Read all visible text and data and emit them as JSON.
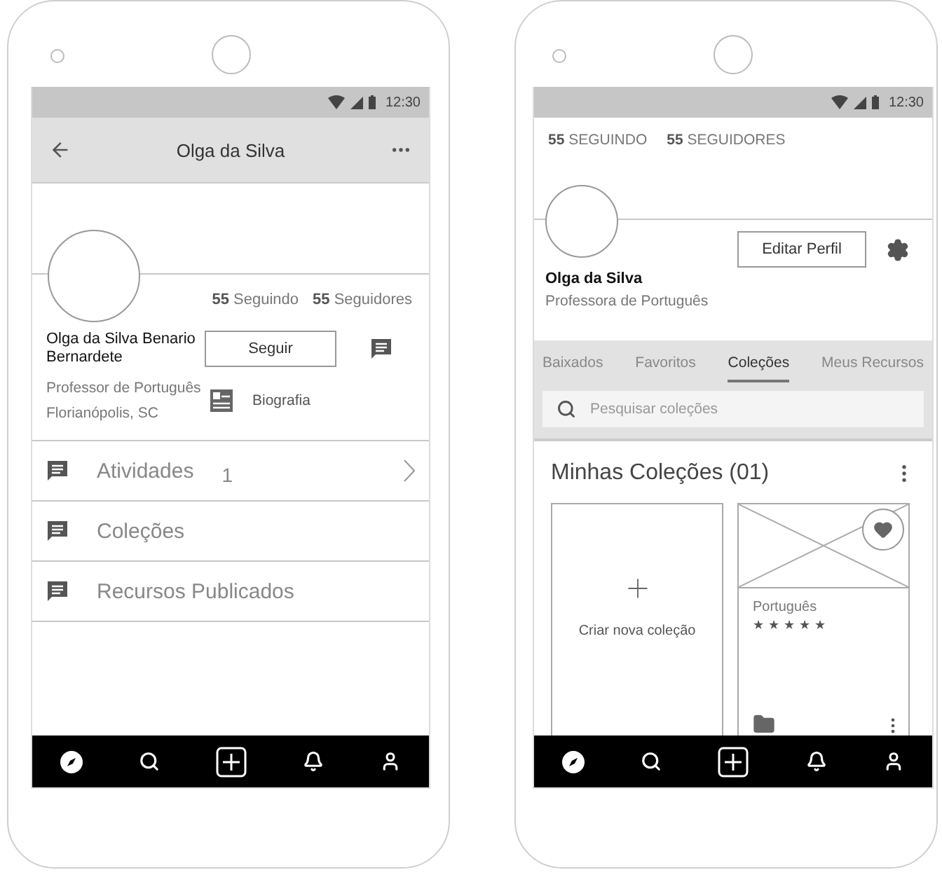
{
  "left_phone": {
    "status_time": "12:30",
    "app_bar": {
      "title": "Olga da Silva"
    },
    "counts": [
      {
        "number": "55",
        "label": "Seguindo"
      },
      {
        "number": "55",
        "label": "Seguidores"
      }
    ],
    "name": "Olga da Silva Benario Bernardete",
    "follow_button": "Seguir",
    "role": "Professor de Português",
    "location": "Florianópolis, SC",
    "bio_link": "Biografia",
    "menu": [
      {
        "label": "Atividades",
        "count": "1",
        "chevron": true
      },
      {
        "label": "Coleções",
        "chevron": false
      },
      {
        "label": "Recursos Publicados",
        "chevron": false
      }
    ]
  },
  "right_phone": {
    "status_time": "12:30",
    "counts": [
      {
        "number": "55",
        "label": "SEGUINDO"
      },
      {
        "number": "55",
        "label": "SEGUIDORES"
      }
    ],
    "edit_button": "Editar Perfil",
    "name": "Olga da Silva",
    "role": "Professora de Português",
    "tabs": [
      {
        "label": "Baixados",
        "selected": false
      },
      {
        "label": "Favoritos",
        "selected": false
      },
      {
        "label": "Coleções",
        "selected": true
      },
      {
        "label": "Meus Recursos",
        "selected": false
      }
    ],
    "search": {
      "placeholder": "Pesquisar coleções"
    },
    "section_title": "Minhas Coleções (01)",
    "cards": [
      {
        "kind": "create",
        "label": "Criar nova coleção"
      },
      {
        "kind": "collection",
        "title": "Português",
        "stars": 5
      }
    ]
  }
}
